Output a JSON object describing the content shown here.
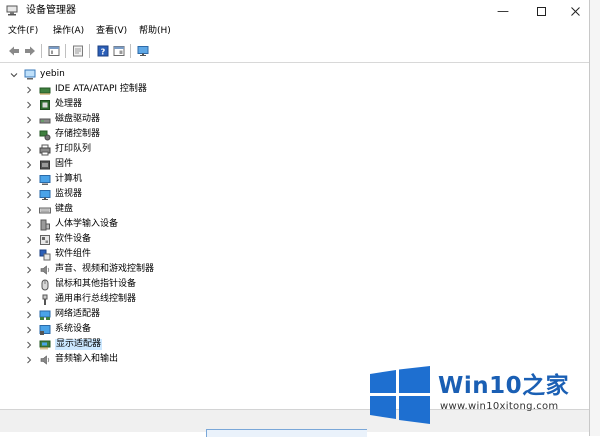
{
  "window": {
    "title": "设备管理器"
  },
  "menu": [
    "文件(F)",
    "操作(A)",
    "查看(V)",
    "帮助(H)"
  ],
  "tree": {
    "root": "yebin",
    "items": [
      {
        "label": "IDE ATA/ATAPI 控制器",
        "icon": "ide-controller-icon"
      },
      {
        "label": "处理器",
        "icon": "processor-icon"
      },
      {
        "label": "磁盘驱动器",
        "icon": "disk-drive-icon"
      },
      {
        "label": "存储控制器",
        "icon": "storage-controller-icon"
      },
      {
        "label": "打印队列",
        "icon": "printer-icon"
      },
      {
        "label": "固件",
        "icon": "firmware-icon"
      },
      {
        "label": "计算机",
        "icon": "computer-icon"
      },
      {
        "label": "监视器",
        "icon": "monitor-icon"
      },
      {
        "label": "键盘",
        "icon": "keyboard-icon"
      },
      {
        "label": "人体学输入设备",
        "icon": "hid-icon"
      },
      {
        "label": "软件设备",
        "icon": "software-device-icon"
      },
      {
        "label": "软件组件",
        "icon": "software-component-icon"
      },
      {
        "label": "声音、视频和游戏控制器",
        "icon": "sound-icon"
      },
      {
        "label": "鼠标和其他指针设备",
        "icon": "mouse-icon"
      },
      {
        "label": "通用串行总线控制器",
        "icon": "usb-icon"
      },
      {
        "label": "网络适配器",
        "icon": "network-adapter-icon"
      },
      {
        "label": "系统设备",
        "icon": "system-device-icon"
      },
      {
        "label": "显示适配器",
        "icon": "display-adapter-icon",
        "selected": true
      },
      {
        "label": "音频输入和输出",
        "icon": "audio-io-icon"
      }
    ]
  },
  "watermark": {
    "brand": "Win10",
    "brand_zh": "之家",
    "url": "www.win10xitong.com"
  },
  "colors": {
    "selection": "#cce8ff",
    "brand_blue": "#1a5fb4"
  }
}
